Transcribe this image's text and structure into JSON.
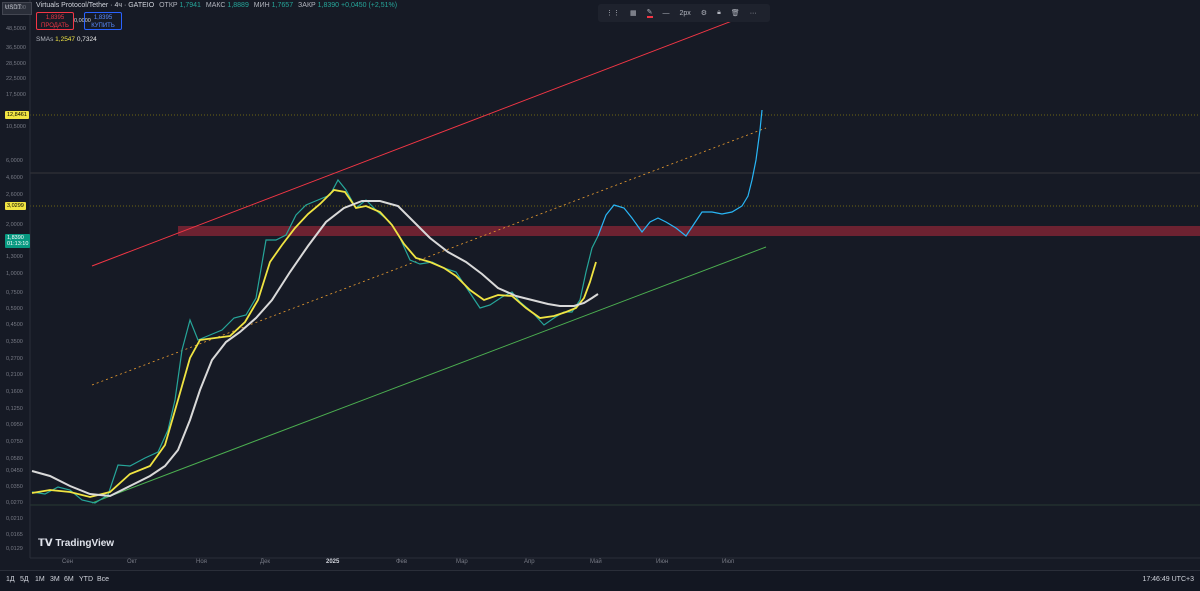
{
  "symbol_box": "USDT",
  "legend": {
    "title": "Virtuals Protocol/Tether · 4ч · GATEIO",
    "open_label": "ОТКР",
    "open": "1,7941",
    "high_label": "МАКС",
    "high": "1,8889",
    "low_label": "МИН",
    "low": "1,7657",
    "close_label": "ЗАКР",
    "close": "1,8390",
    "change": "+0,0450 (+2,51%)"
  },
  "trade": {
    "sell_price": "1,8395",
    "sell_label": "ПРОДАТЬ",
    "spread": "0,0000",
    "buy_price": "1,8395",
    "buy_label": "КУПИТЬ"
  },
  "sma": {
    "label": "SMAs",
    "v1": "1,2547",
    "v2": "0,7324"
  },
  "toolbar": {
    "width_label": "2px"
  },
  "price_axis": [
    "62,0000",
    "48,5000",
    "36,5000",
    "28,5000",
    "22,5000",
    "17,5000",
    "10,5000",
    "6,0000",
    "4,6000",
    "2,6000",
    "2,0000",
    "1,3000",
    "1,0000",
    "0,7500",
    "0,5900",
    "0,4500",
    "0,3500",
    "0,2700",
    "0,2100",
    "0,1600",
    "0,1250",
    "0,0950",
    "0,0750",
    "0,0580",
    "0,0450",
    "0,0350",
    "0,0270",
    "0,0210",
    "0,0165",
    "0,0129"
  ],
  "badges": {
    "b1": "12,8461",
    "b2": "3,0299",
    "current": "1,8390",
    "countdown": "01:13:10"
  },
  "months": [
    "Сен",
    "Окт",
    "Ноя",
    "Дек",
    "2025",
    "Фев",
    "Мар",
    "Апр",
    "Май",
    "Июн",
    "Июл"
  ],
  "watermark": "TradingView",
  "timeframes": [
    "1Д",
    "5Д",
    "1М",
    "3М",
    "6М",
    "YTD",
    "Все"
  ],
  "clock": "17:46:49 UTC+3",
  "colors": {
    "yellow_ma": "#f0e442",
    "white_ma": "#d9d9d9",
    "upper_channel": "#f23645",
    "lower_channel": "#4caf50",
    "forecast": "#29b6f6",
    "zone": "#8b2635"
  }
}
